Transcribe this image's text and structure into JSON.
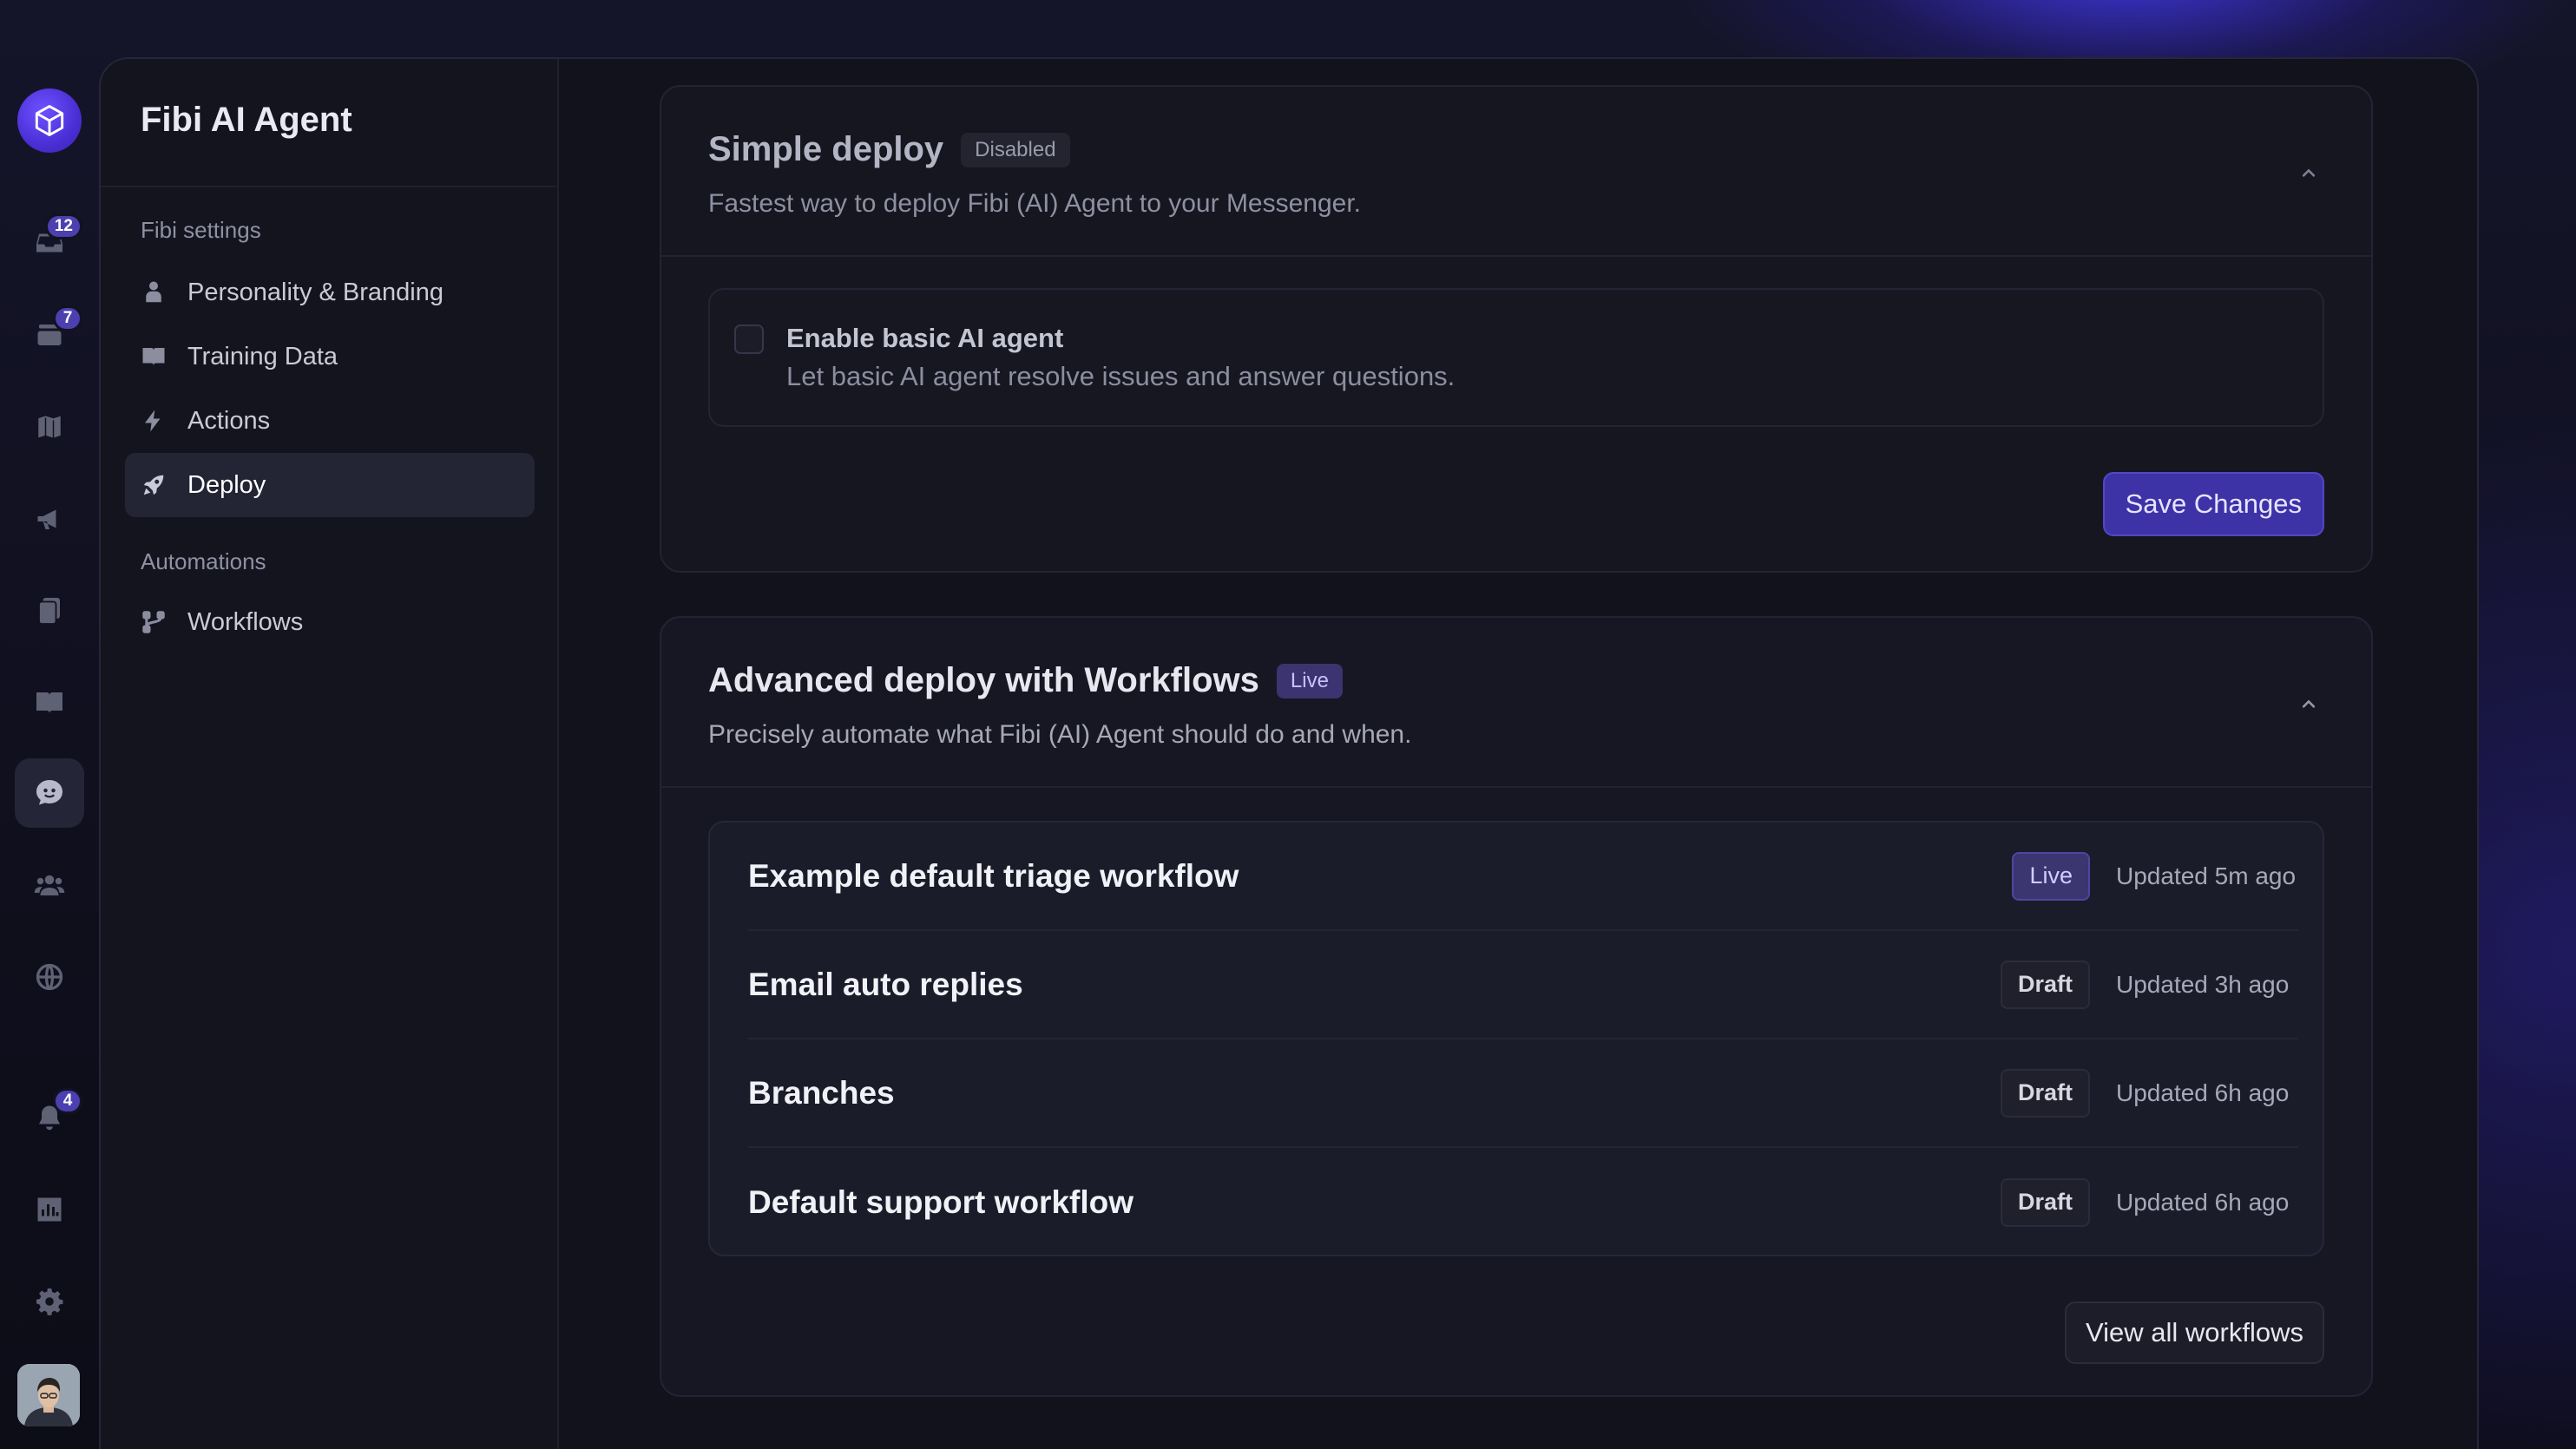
{
  "rail": {
    "badges": {
      "inbox": "12",
      "tickets": "7",
      "notifications": "4"
    },
    "items": [
      "logo-icon",
      "inbox-icon",
      "tickets-icon",
      "map-icon",
      "megaphone-icon",
      "documents-icon",
      "book-icon",
      "ai-agent-icon",
      "contacts-icon",
      "globe-icon",
      "bell-icon",
      "reports-icon",
      "gear-icon"
    ]
  },
  "subnav": {
    "title": "Fibi AI Agent",
    "settings_label": "Fibi settings",
    "settings_items": [
      {
        "label": "Personality & Branding",
        "icon": "person-icon"
      },
      {
        "label": "Training Data",
        "icon": "book-open-icon"
      },
      {
        "label": "Actions",
        "icon": "bolt-icon"
      },
      {
        "label": "Deploy",
        "icon": "rocket-icon",
        "active": true
      }
    ],
    "automations_label": "Automations",
    "automation_items": [
      {
        "label": "Workflows",
        "icon": "workflow-icon"
      }
    ]
  },
  "simple": {
    "title": "Simple deploy",
    "status": "Disabled",
    "subtitle": "Fastest way to deploy Fibi (AI) Agent to your Messenger.",
    "option_title": "Enable basic AI agent",
    "option_desc": "Let basic AI agent resolve issues and answer questions.",
    "option_checked": false,
    "save_label": "Save Changes"
  },
  "advanced": {
    "title": "Advanced deploy with Workflows",
    "status": "Live",
    "subtitle": "Precisely automate what Fibi (AI) Agent should do and when.",
    "workflows": [
      {
        "name": "Example default triage workflow",
        "status": "Live",
        "updated": "Updated 5m ago"
      },
      {
        "name": "Email auto replies",
        "status": "Draft",
        "updated": "Updated 3h ago"
      },
      {
        "name": "Branches",
        "status": "Draft",
        "updated": "Updated 6h ago"
      },
      {
        "name": "Default support workflow",
        "status": "Draft",
        "updated": "Updated 6h ago"
      }
    ],
    "view_all_label": "View all workflows"
  },
  "colors": {
    "accent": "#3d33a6",
    "live_badge": "#3b3470",
    "background": "#12121c"
  }
}
